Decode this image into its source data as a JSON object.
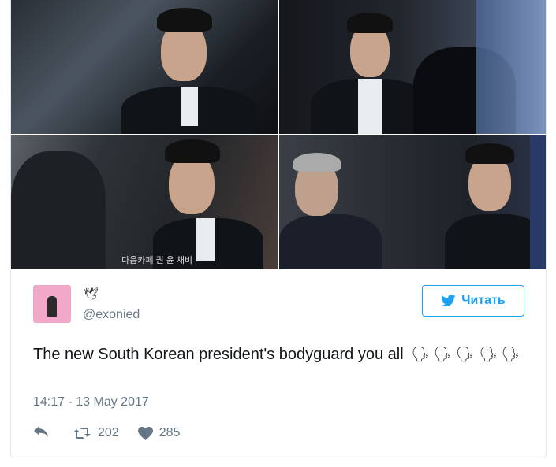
{
  "photos": [
    {
      "alt": "photo-1"
    },
    {
      "alt": "photo-2"
    },
    {
      "alt": "photo-3"
    },
    {
      "alt": "photo-4"
    }
  ],
  "photo3_watermark": "다음카페 권 윤 채비",
  "tweet": {
    "name_icon": "🕊",
    "handle": "@exonied",
    "follow_label": "Читать",
    "text": "The new South Korean president's bodyguard you all",
    "emojis": [
      "🗣",
      "🗣",
      "🗣",
      "🗣",
      "🗣"
    ],
    "timestamp": "14:17 - 13 May 2017",
    "retweets": "202",
    "likes": "285"
  },
  "colors": {
    "accent": "#1da1f2",
    "muted": "#657786",
    "avatar_bg": "#f2a8c8"
  }
}
